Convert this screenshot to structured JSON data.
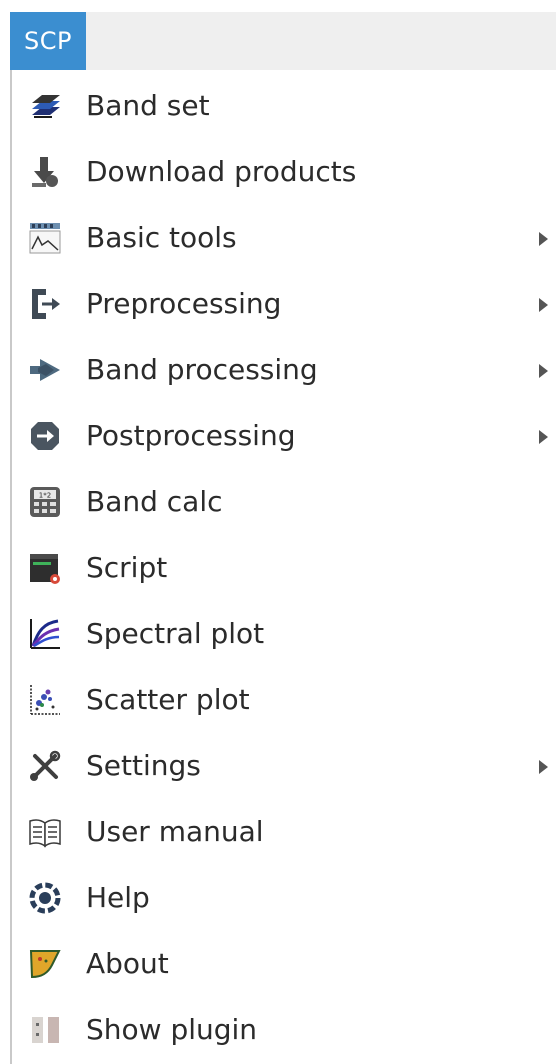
{
  "menubar": {
    "title": "SCP"
  },
  "menu": {
    "items": [
      {
        "label": "Band set",
        "icon": "band-set-icon",
        "submenu": false
      },
      {
        "label": "Download products",
        "icon": "download-icon",
        "submenu": false
      },
      {
        "label": "Basic tools",
        "icon": "basic-tools-icon",
        "submenu": true
      },
      {
        "label": "Preprocessing",
        "icon": "preprocessing-icon",
        "submenu": true
      },
      {
        "label": "Band processing",
        "icon": "band-processing-icon",
        "submenu": true
      },
      {
        "label": "Postprocessing",
        "icon": "postprocessing-icon",
        "submenu": true
      },
      {
        "label": "Band calc",
        "icon": "calculator-icon",
        "submenu": false
      },
      {
        "label": "Script",
        "icon": "script-icon",
        "submenu": false
      },
      {
        "label": "Spectral plot",
        "icon": "spectral-plot-icon",
        "submenu": false
      },
      {
        "label": "Scatter plot",
        "icon": "scatter-plot-icon",
        "submenu": false
      },
      {
        "label": "Settings",
        "icon": "settings-icon",
        "submenu": true
      },
      {
        "label": "User manual",
        "icon": "user-manual-icon",
        "submenu": false
      },
      {
        "label": "Help",
        "icon": "help-icon",
        "submenu": false
      },
      {
        "label": "About",
        "icon": "about-icon",
        "submenu": false
      },
      {
        "label": "Show plugin",
        "icon": "show-plugin-icon",
        "submenu": false
      }
    ]
  },
  "colors": {
    "accent": "#3b8ed0",
    "menubar_bg": "#efefef",
    "text": "#2b2b2b"
  }
}
